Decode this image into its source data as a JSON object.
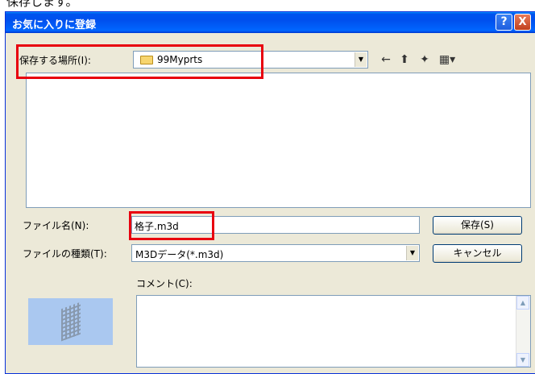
{
  "cut_text": "保存します。",
  "dialog": {
    "title": "お気に入りに登録",
    "help_label": "?",
    "close_label": "X"
  },
  "location": {
    "label": "保存する場所(I):",
    "value": "99Myprts"
  },
  "filename": {
    "label": "ファイル名(N):",
    "value": "格子.m3d"
  },
  "filetype": {
    "label": "ファイルの種類(T):",
    "value": "M3Dデータ(*.m3d)"
  },
  "comment": {
    "label": "コメント(C):"
  },
  "buttons": {
    "save": "保存(S)",
    "cancel": "キャンセル"
  },
  "toolbar": {
    "back_icon": "←",
    "up_icon": "⬆",
    "new_folder_icon": "✦",
    "view_icon": "▦▾"
  },
  "highlight_color": "#e8000f"
}
